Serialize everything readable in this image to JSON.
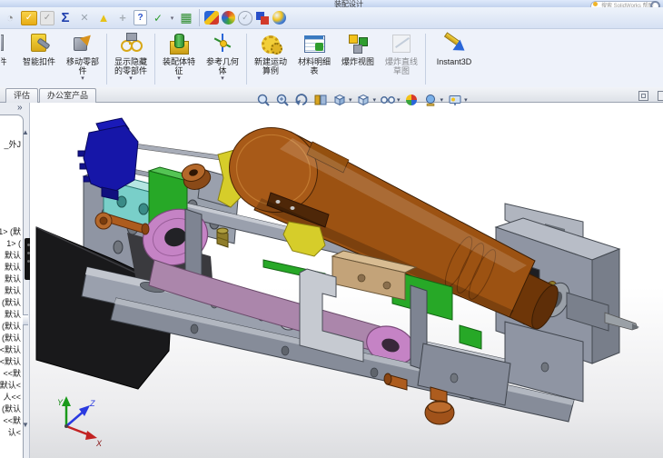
{
  "window": {
    "title_fragment": "装配设计",
    "search_text": "搜索 SolidWorks 帮助"
  },
  "ui": {
    "caret": "▾",
    "chevron": "»",
    "scroll_up": "▲",
    "scroll_down": "▼"
  },
  "toolbar": {
    "icons": [
      {
        "name": "design-binder",
        "glyph": "◔"
      },
      {
        "name": "select-folder-check",
        "glyph": "✓"
      },
      {
        "name": "toggle-check",
        "glyph": "✓"
      },
      {
        "name": "equations",
        "glyph": "Σ"
      },
      {
        "name": "measure",
        "glyph": "✕"
      },
      {
        "name": "draft-analysis",
        "glyph": "▲"
      },
      {
        "name": "align",
        "glyph": "+"
      },
      {
        "name": "file-properties",
        "glyph": "?"
      },
      {
        "name": "design-check",
        "glyph": "✓"
      },
      {
        "name": "dropdown",
        "glyph": "▾"
      },
      {
        "name": "design-table",
        "glyph": "▦"
      },
      {
        "name": "photoview-preview",
        "glyph": ""
      },
      {
        "name": "appearances",
        "glyph": ""
      },
      {
        "name": "circle-check",
        "glyph": "✓"
      },
      {
        "name": "copy-appearance",
        "glyph": ""
      },
      {
        "name": "photoview-360",
        "glyph": ""
      }
    ]
  },
  "ribbon": {
    "buttons": [
      {
        "label": "零部件"
      },
      {
        "label": "智能扣件"
      },
      {
        "label": "移动零部件"
      },
      {
        "label": "显示隐藏的零部件"
      },
      {
        "label": "装配体特征"
      },
      {
        "label": "参考几何体"
      },
      {
        "label": "新建运动算例"
      },
      {
        "label": "材料明细表"
      },
      {
        "label": "爆炸视图"
      },
      {
        "label": "爆炸直线草图"
      },
      {
        "label": "Instant3D"
      }
    ]
  },
  "tabs": {
    "left": [
      {
        "label": "评估"
      },
      {
        "label": "办公室产品"
      }
    ]
  },
  "viewport": {
    "heads_up": [
      "zoom-to-fit",
      "zoom-to-area",
      "previous-view",
      "section-view",
      "view-orientation",
      "display-style",
      "hide-show-items",
      "edit-appearance",
      "apply-scene",
      "view-settings"
    ]
  },
  "sidebar": {
    "tree_fragments": [
      "_外J",
      "1> (默",
      "1> (",
      "默认",
      "默认",
      "默认",
      "默认",
      "(默认",
      "默认",
      "(默认",
      "(默认",
      "<默认",
      "<默认",
      "<<默",
      "默认<",
      "人<<",
      "(默认",
      "<<默",
      "认<"
    ]
  },
  "triad": {
    "x": "X",
    "y": "Y",
    "z": "Z"
  },
  "model": {
    "colors": {
      "frame": "#8f95a3",
      "frame_light": "#b8bdc7",
      "frame_dark": "#787e8a",
      "rail": "#9aa0ad",
      "cylinder": "#9c5212",
      "cylinder_dark": "#6e3608",
      "black": "#19191b",
      "blue": "#1616a8",
      "cyan": "#79cfc9",
      "green": "#27a827",
      "pink": "#c583c5",
      "mauve": "#ab86ab",
      "yellow": "#d6cd2a",
      "tan": "#c3a379",
      "bolt": "#ad5c1e",
      "brass": "#8f7d2a",
      "shadow": "#3a3a3e",
      "bracket_light": "#c6cad1"
    }
  }
}
